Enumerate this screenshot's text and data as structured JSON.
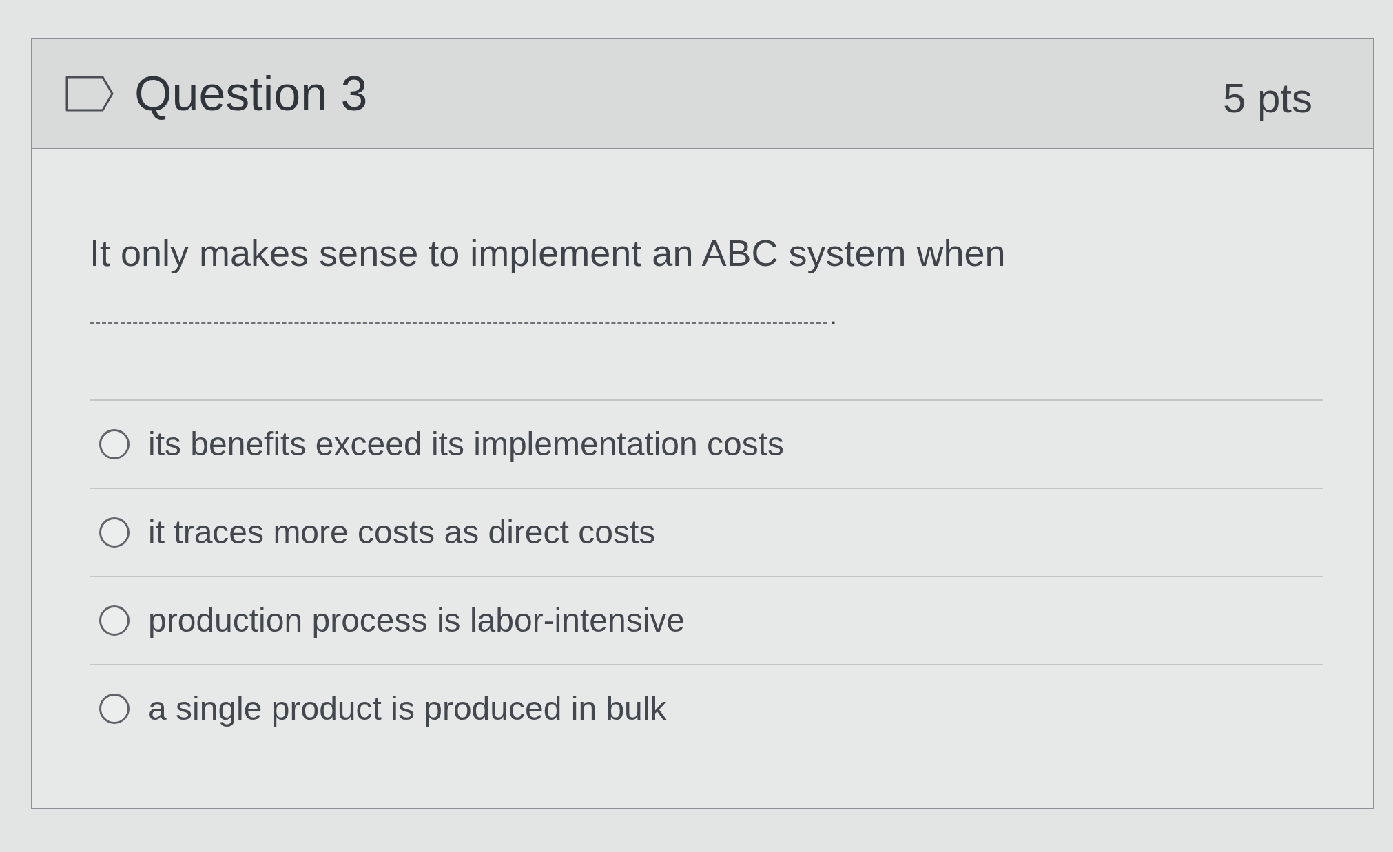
{
  "question": {
    "title": "Question 3",
    "points": "5 pts",
    "flagged": false,
    "text": "It only makes sense to implement an ABC system when",
    "blank_end": ".",
    "answers": [
      {
        "label": "its benefits exceed its implementation costs",
        "selected": false
      },
      {
        "label": "it traces more costs as direct costs",
        "selected": false
      },
      {
        "label": "production process is labor-intensive",
        "selected": false
      },
      {
        "label": "a single product is produced in bulk",
        "selected": false
      }
    ]
  }
}
